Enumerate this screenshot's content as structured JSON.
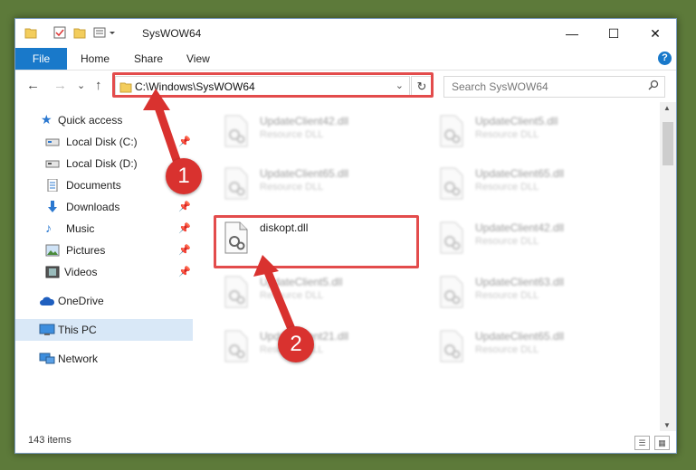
{
  "window": {
    "title": "SysWOW64"
  },
  "titlebar": {
    "minimize": "—",
    "maximize": "☐",
    "close": "✕"
  },
  "ribbon": {
    "file": "File",
    "home": "Home",
    "share": "Share",
    "view": "View",
    "help": "?"
  },
  "nav": {
    "back": "←",
    "forward": "→",
    "recent": "⌄",
    "up": "↑"
  },
  "address": {
    "path": "C:\\Windows\\SysWOW64",
    "dropdown": "⌄",
    "refresh": "↻"
  },
  "search": {
    "placeholder": "Search SysWOW64",
    "icon": "search-icon"
  },
  "sidebar": {
    "quick_access": "Quick access",
    "items": [
      {
        "label": "Local Disk (C:)",
        "icon": "drive-icon",
        "pinned": true
      },
      {
        "label": "Local Disk (D:)",
        "icon": "drive-icon",
        "pinned": false
      },
      {
        "label": "Documents",
        "icon": "documents-icon",
        "pinned": true
      },
      {
        "label": "Downloads",
        "icon": "downloads-icon",
        "pinned": true
      },
      {
        "label": "Music",
        "icon": "music-icon",
        "pinned": true
      },
      {
        "label": "Pictures",
        "icon": "pictures-icon",
        "pinned": true
      },
      {
        "label": "Videos",
        "icon": "videos-icon",
        "pinned": true
      }
    ],
    "onedrive": "OneDrive",
    "this_pc": "This PC",
    "network": "Network"
  },
  "files": [
    {
      "name": "UpdateClient42.dll",
      "type": "Resource DLL"
    },
    {
      "name": "UpdateClient5.dll",
      "type": "Resource DLL"
    },
    {
      "name": "UpdateClient65.dll",
      "type": "Resource DLL"
    },
    {
      "name": "UpdateClient65.dll",
      "type": "Resource DLL"
    },
    {
      "name": "diskopt.dll",
      "type": ""
    },
    {
      "name": "UpdateClient42.dll",
      "type": "Resource DLL"
    },
    {
      "name": "UpdateClient5.dll",
      "type": "Resource DLL"
    },
    {
      "name": "UpdateClient63.dll",
      "type": "Resource DLL"
    },
    {
      "name": "UpdateClient21.dll",
      "type": "Resource DLL"
    },
    {
      "name": "UpdateClient65.dll",
      "type": "Resource DLL"
    }
  ],
  "status": {
    "items": "143 items"
  },
  "callouts": {
    "one": "1",
    "two": "2"
  },
  "colors": {
    "accent": "#1979ca",
    "highlight": "#e34c4c",
    "badge": "#d9322f"
  }
}
